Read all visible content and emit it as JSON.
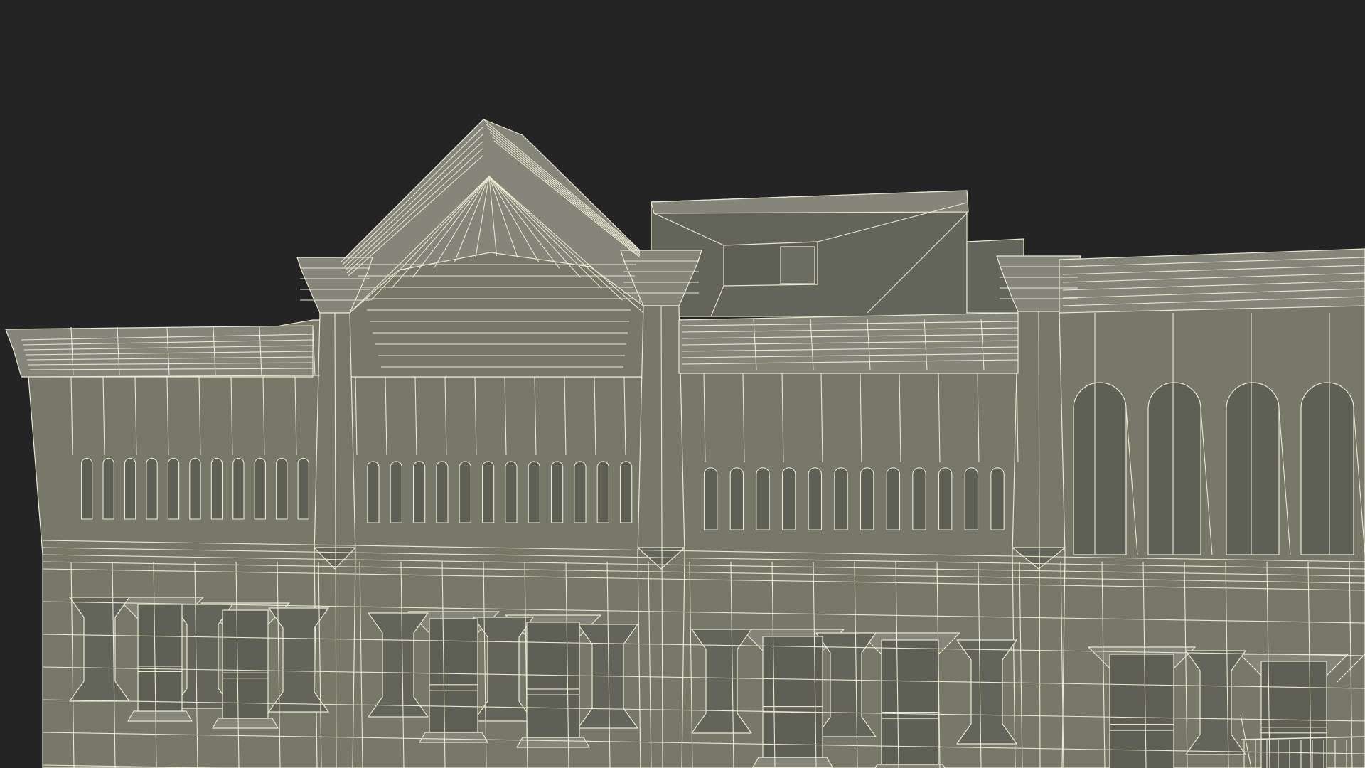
{
  "scene": {
    "subject": "wireframe-building-facade",
    "colors": {
      "background": "#242424",
      "facade": "#77776a",
      "facade_dark": "#63645a",
      "facade_light": "#85857a",
      "recess": "#5f6055",
      "wire": "#e9e8d2"
    }
  }
}
